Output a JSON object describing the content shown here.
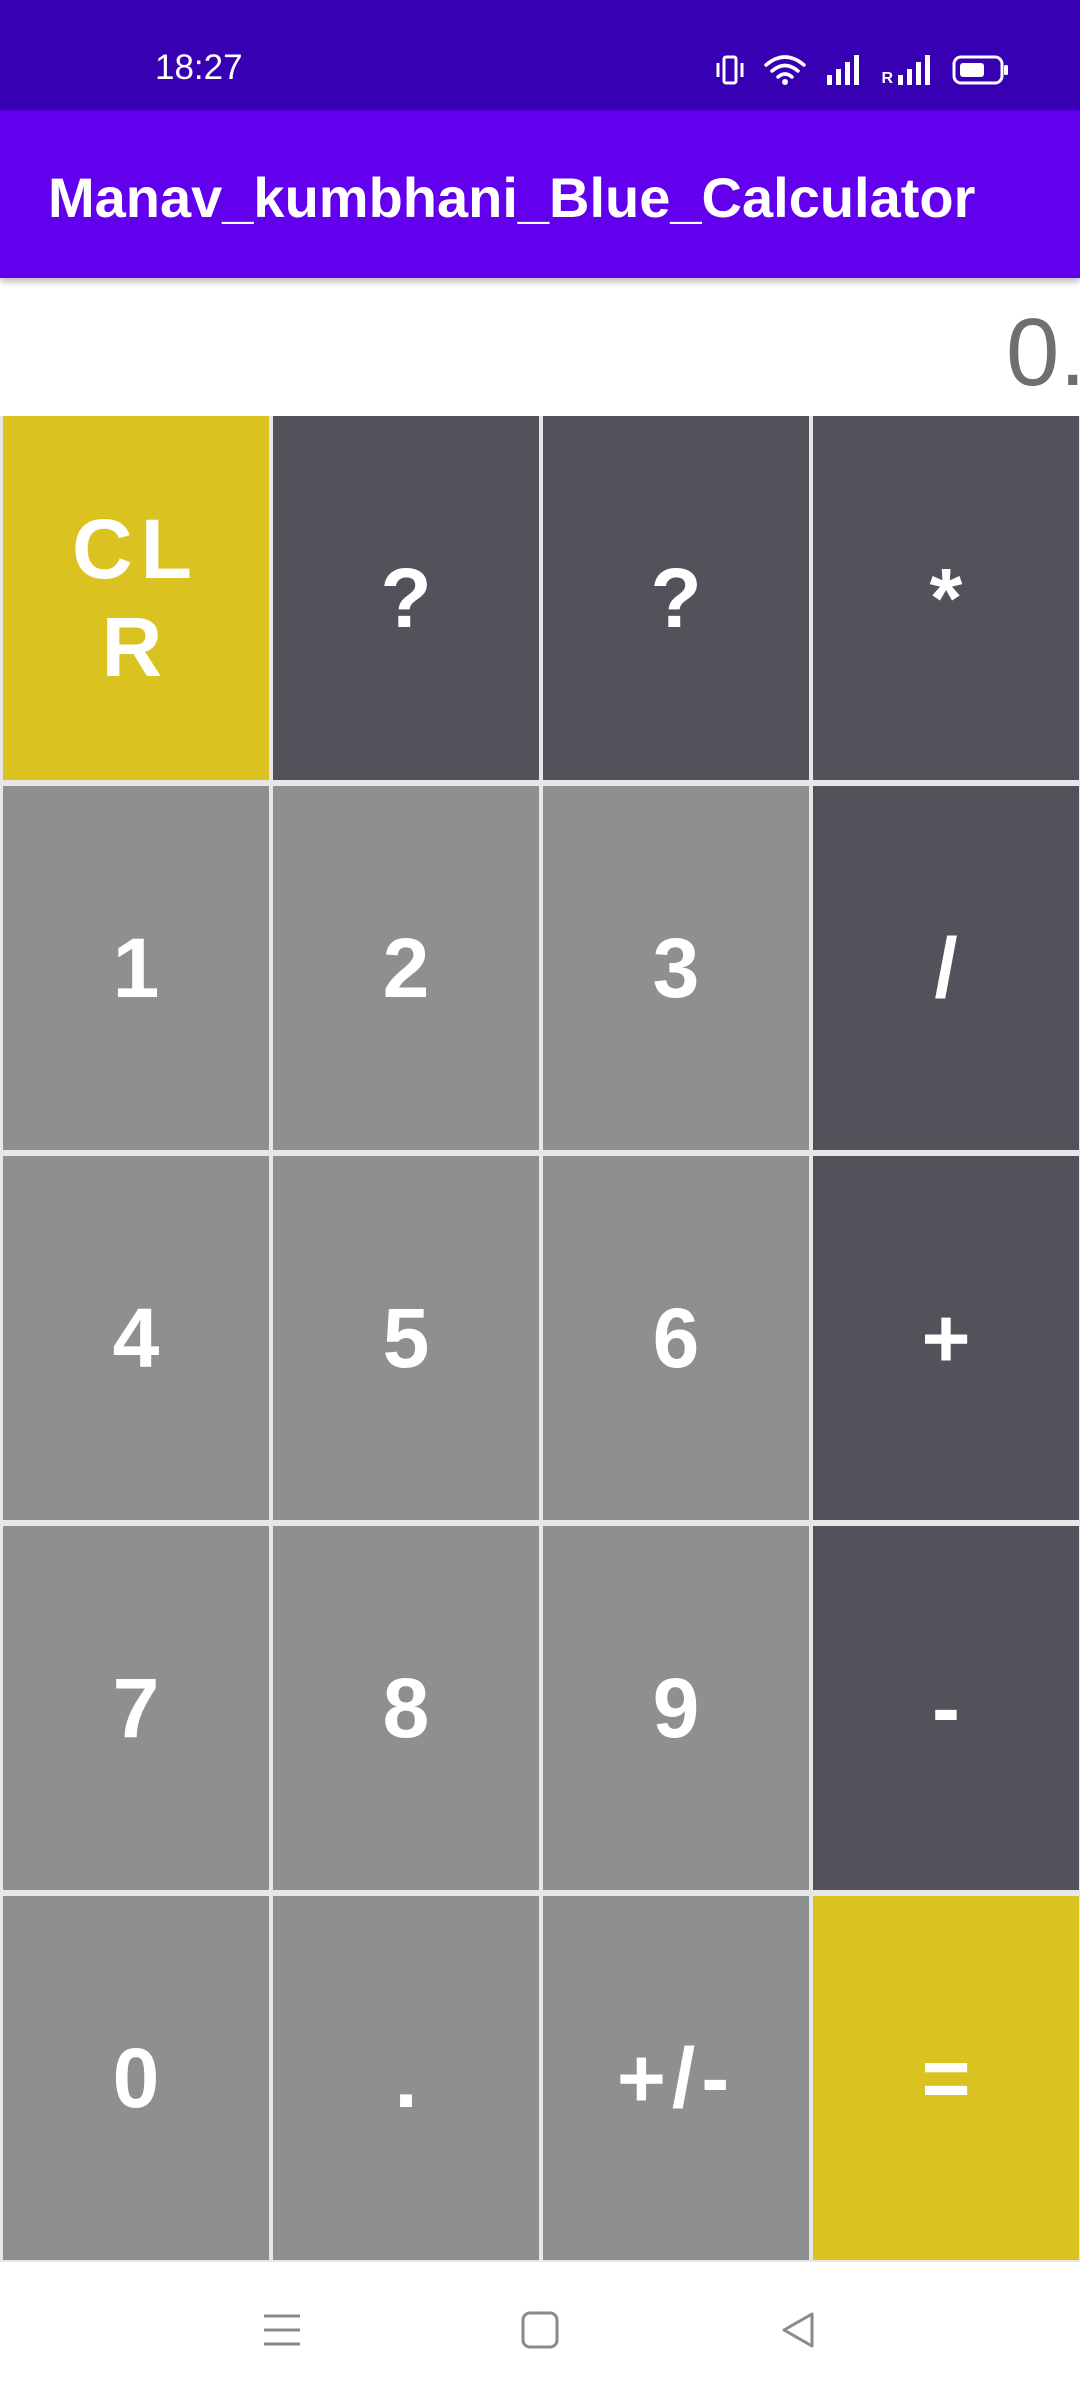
{
  "status_bar": {
    "time": "18:27",
    "icons": [
      "vibrate-icon",
      "wifi-icon",
      "signal-icon",
      "roaming-signal-icon",
      "battery-icon"
    ],
    "roaming_label": "R",
    "background": "#3700B3"
  },
  "app_bar": {
    "title": "Manav_kumbhani_Blue_Calculator",
    "background": "#6200EE"
  },
  "display": {
    "value": "0."
  },
  "keypad": {
    "colors": {
      "number": "#8E8F91",
      "operator": "#52535A",
      "accent": "#DAC221"
    },
    "row1": [
      "CLR",
      "?",
      "?",
      "*"
    ],
    "row2": [
      "1",
      "2",
      "3",
      "/"
    ],
    "row3": [
      "4",
      "5",
      "6",
      "+"
    ],
    "row4": [
      "7",
      "8",
      "9",
      "-"
    ],
    "row5": [
      "0",
      ".",
      "+/-",
      "="
    ]
  },
  "nav_bar": {
    "buttons": [
      "menu-icon",
      "home-icon",
      "back-icon"
    ]
  }
}
